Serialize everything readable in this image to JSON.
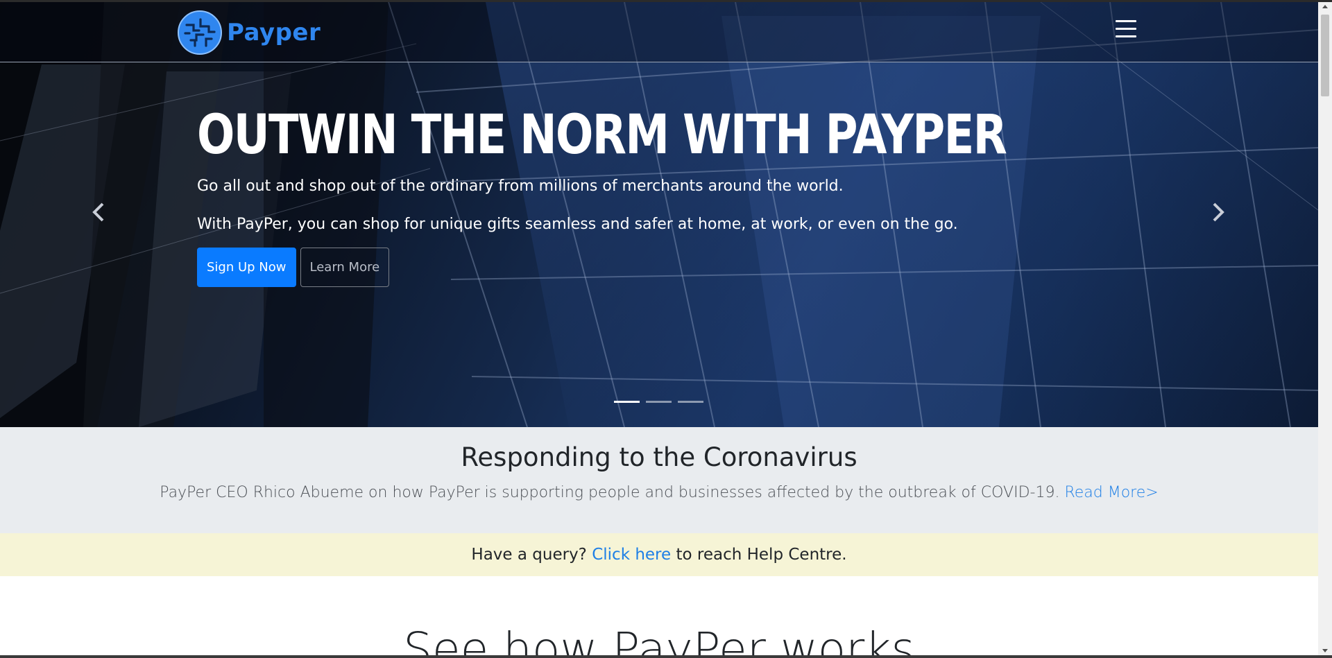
{
  "brand": {
    "name": "Payper",
    "logo_icon": "circuit-globe-logo-icon"
  },
  "navbar": {
    "menu_icon": "hamburger-menu-icon"
  },
  "hero": {
    "title": "OUTWIN THE NORM WITH PAYPER",
    "line1": "Go all out and shop out of the ordinary from millions of merchants around the world.",
    "line2": "With PayPer, you can shop for unique gifts seamless and safer at home, at work, or even on the go.",
    "signup_label": "Sign Up Now",
    "learn_label": "Learn More",
    "prev_icon": "chevron-left-icon",
    "next_icon": "chevron-right-icon",
    "slides": 3,
    "active_slide": 1
  },
  "news": {
    "title": "Responding to the Coronavirus",
    "text": "PayPer CEO Rhico Abueme on how PayPer is supporting people and businesses affected by the outbreak of COVID-19.",
    "link": "Read More>"
  },
  "query": {
    "prefix": "Have a query?",
    "link": "Click here",
    "suffix": "to reach Help Centre."
  },
  "how": {
    "title": "See how PayPer works"
  },
  "colors": {
    "primary": "#0a7bff",
    "brand_blue": "#2f86ef",
    "link": "#1e7fe6",
    "news_bg": "#e9ecef",
    "query_bg": "#f6f4d6"
  }
}
